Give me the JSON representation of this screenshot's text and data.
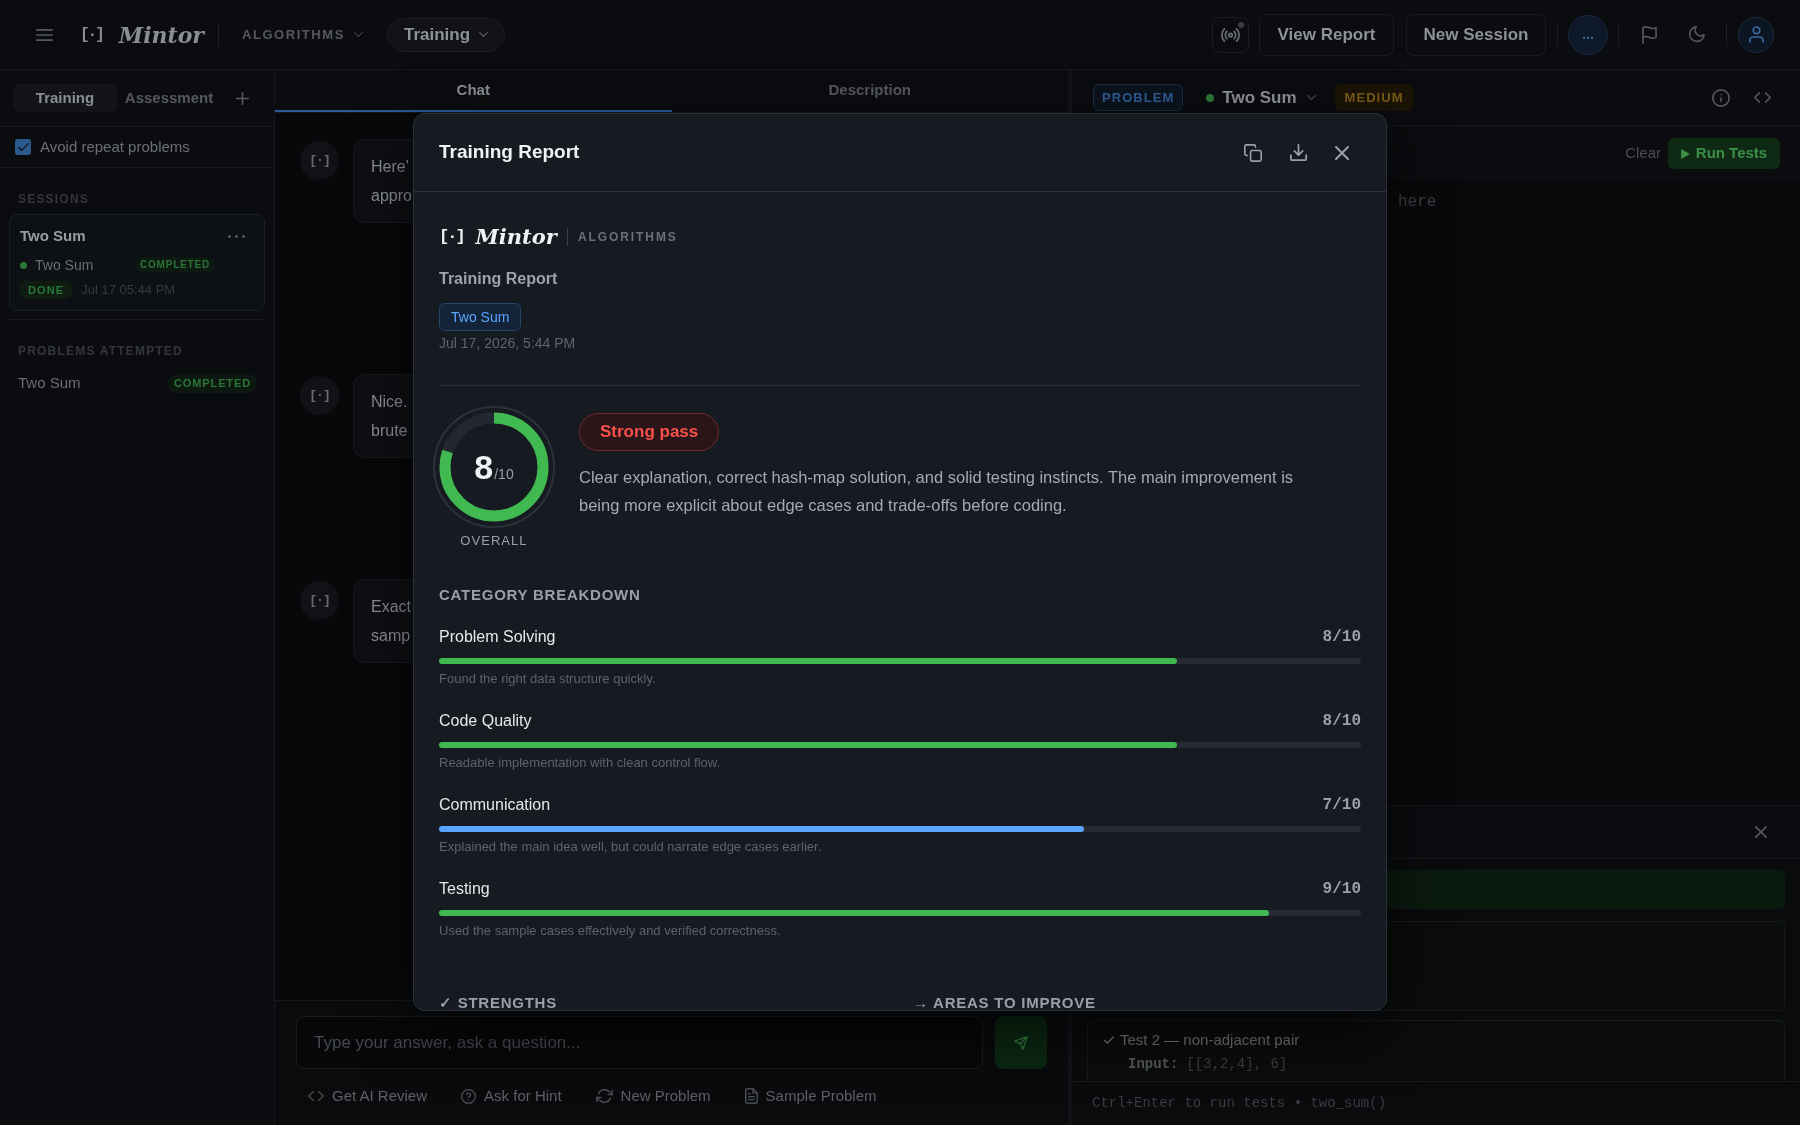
{
  "top_bar": {
    "logo_mark": "[·]",
    "logo_text": "Mintor",
    "track": "ALGORITHMS",
    "mode": "Training",
    "buttons": [
      "View Report",
      "New Session"
    ],
    "more_button": "..."
  },
  "sidebar": {
    "tabs": [
      {
        "label": "Training",
        "selected": true
      },
      {
        "label": "Assessment",
        "selected": false
      }
    ],
    "avoid_repeat": {
      "label": "Avoid repeat problems",
      "checked": true
    },
    "sessions_heading": "SESSIONS",
    "sessions": [
      {
        "title": "Two Sum",
        "selected": true,
        "problem": "Two Sum",
        "problem_status": "COMPLETED",
        "status": "DONE",
        "time": "Jul 17 05:44 PM"
      }
    ],
    "problems_heading": "PROBLEMS ATTEMPTED",
    "problems": [
      {
        "name": "Two Sum",
        "status": "COMPLETED"
      }
    ]
  },
  "chat": {
    "tabs": [
      {
        "label": "Chat",
        "selected": true
      },
      {
        "label": "Description",
        "selected": false
      }
    ],
    "messages": [
      {
        "kind": "assistant",
        "avatar": "[·]",
        "lines": [
          "Here'",
          "appro"
        ]
      },
      {
        "kind": "user"
      },
      {
        "kind": "assistant",
        "avatar": "[·]",
        "lines": [
          "Nice.",
          "brute"
        ]
      },
      {
        "kind": "user"
      },
      {
        "kind": "assistant",
        "avatar": "[·]",
        "lines": [
          "Exact",
          "samp"
        ]
      }
    ],
    "input": {
      "placeholder": "Type your answer, ask a question..."
    },
    "actions": [
      "Get AI Review",
      "Ask for Hint",
      "New Problem",
      "Sample Problem"
    ]
  },
  "problem_panel": {
    "badge": "PROBLEM",
    "title": "Two Sum",
    "difficulty": "MEDIUM",
    "clear": "Clear",
    "run": "Run Tests",
    "editor": {
      "placeholder": "here"
    },
    "tests": [
      {
        "passed": true,
        "name": "Test 2 — non-adjacent pair",
        "input_label": "Input:",
        "input": "[[3,2,4], 6]"
      }
    ],
    "footer": "Ctrl+Enter to run tests • two_sum()"
  },
  "report": {
    "title": "Training Report",
    "logo_mark": "[·]",
    "logo_text": "Mintor",
    "track": "ALGORITHMS",
    "subtitle": "Training Report",
    "problem_tag": "Two Sum",
    "date": "Jul 17, 2026, 5:44 PM",
    "overall": {
      "score": "8",
      "max": "/10",
      "label": "OVERALL",
      "level": 0.8
    },
    "verdict": "Strong pass",
    "summary": "Clear explanation, correct hash-map solution, and solid testing instincts. The main improvement is being more explicit about edge cases and trade-offs before coding.",
    "breakdown_heading": "CATEGORY BREAKDOWN",
    "categories": [
      {
        "name": "Problem Solving",
        "score": "8/10",
        "level": 0.8,
        "color": "#3fb950",
        "note": "Found the right data structure quickly."
      },
      {
        "name": "Code Quality",
        "score": "8/10",
        "level": 0.8,
        "color": "#3fb950",
        "note": "Readable implementation with clean control flow."
      },
      {
        "name": "Communication",
        "score": "7/10",
        "level": 0.7,
        "color": "#58a6ff",
        "note": "Explained the main idea well, but could narrate edge cases earlier."
      },
      {
        "name": "Testing",
        "score": "9/10",
        "level": 0.9,
        "color": "#3fb950",
        "note": "Used the sample cases effectively and verified correctness."
      }
    ],
    "sections": [
      "✓ STRENGTHS",
      "→ AREAS TO IMPROVE"
    ]
  }
}
